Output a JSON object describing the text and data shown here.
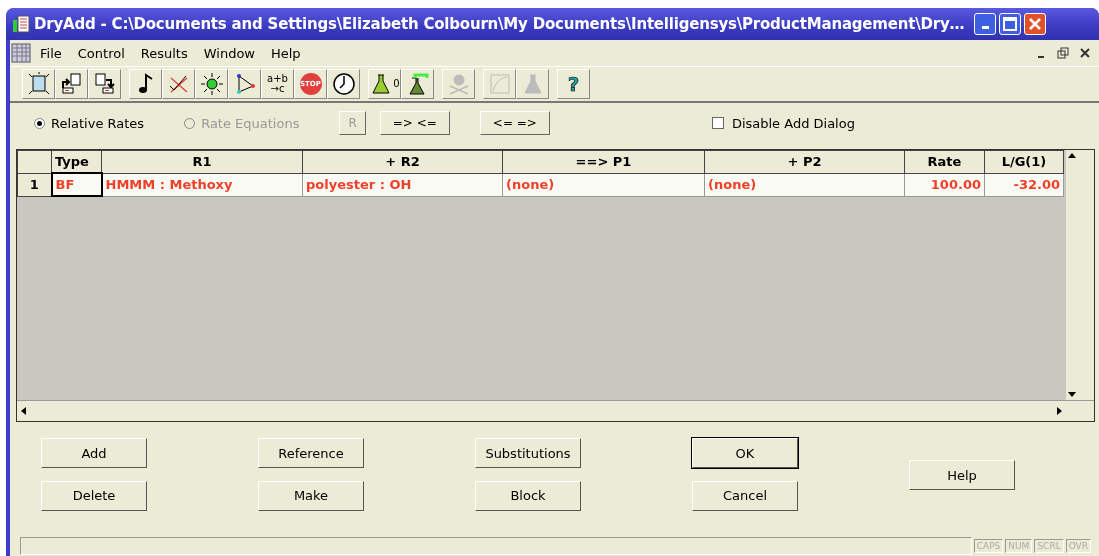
{
  "window": {
    "title": "DryAdd - C:\\Documents and Settings\\Elizabeth Colbourn\\My Documents\\Intelligensys\\ProductManagement\\Dry…"
  },
  "menu": [
    {
      "label": "File"
    },
    {
      "label": "Control"
    },
    {
      "label": "Results"
    },
    {
      "label": "Window"
    },
    {
      "label": "Help"
    }
  ],
  "toolbar": [
    [
      {
        "kind": "new",
        "disabled": false
      },
      {
        "kind": "import",
        "disabled": false
      },
      {
        "kind": "export",
        "disabled": false
      }
    ],
    [
      {
        "kind": "note",
        "disabled": false
      },
      {
        "kind": "cross",
        "disabled": false
      },
      {
        "kind": "sun",
        "disabled": false
      },
      {
        "kind": "triangle",
        "disabled": false
      },
      {
        "kind": "text",
        "label": "a+b\n→c",
        "disabled": false
      },
      {
        "kind": "stop",
        "label": "STOP",
        "disabled": false
      },
      {
        "kind": "clock",
        "disabled": false
      }
    ],
    [
      {
        "kind": "flask",
        "label": "0",
        "disabled": false
      },
      {
        "kind": "flask-tube",
        "disabled": false
      }
    ],
    [
      {
        "kind": "skull",
        "disabled": true
      }
    ],
    [
      {
        "kind": "curve",
        "disabled": true
      },
      {
        "kind": "flask",
        "disabled": true
      }
    ],
    [
      {
        "kind": "text",
        "label": "?",
        "disabled": false
      }
    ]
  ],
  "options": {
    "modes": [
      {
        "label": "Relative Rates",
        "selected": true,
        "disabled": false
      },
      {
        "label": "Rate Equations",
        "selected": false,
        "disabled": true
      }
    ],
    "buttons": [
      {
        "label": "R",
        "disabled": true
      },
      {
        "label": "=> <=",
        "disabled": false
      },
      {
        "label": "<= =>",
        "disabled": false
      }
    ],
    "checkbox": {
      "label": "Disable Add Dialog",
      "checked": false
    }
  },
  "table": {
    "columns": [
      {
        "label": "Type"
      },
      {
        "label": "R1"
      },
      {
        "label": "+ R2"
      },
      {
        "label": "==> P1"
      },
      {
        "label": "+ P2"
      },
      {
        "label": "Rate"
      },
      {
        "label": "L/G(1)"
      }
    ],
    "rows": [
      {
        "number": "1",
        "cells": [
          "BF",
          "HMMM : Methoxy",
          "polyester : OH",
          "(none)",
          "(none)",
          "100.00",
          "-32.00"
        ]
      }
    ]
  },
  "buttons": [
    {
      "label": "Add",
      "default": false
    },
    {
      "label": "Delete",
      "default": false
    },
    {
      "label": "Reference",
      "default": false
    },
    {
      "label": "Make",
      "default": false
    },
    {
      "label": "Substitutions",
      "default": false
    },
    {
      "label": "Block",
      "default": false
    },
    {
      "label": "OK",
      "default": true
    },
    {
      "label": "Cancel",
      "default": false
    },
    {
      "label": "Help",
      "default": false
    }
  ],
  "status_bar": {
    "indicators": [
      {
        "label": "CAPS"
      },
      {
        "label": "NUM"
      },
      {
        "label": "SCRL"
      },
      {
        "label": "OVR"
      }
    ]
  }
}
